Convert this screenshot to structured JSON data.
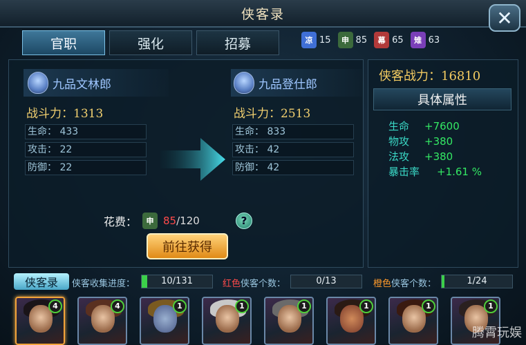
{
  "window": {
    "title": "侠客录"
  },
  "tabs": [
    {
      "label": "官职"
    },
    {
      "label": "强化"
    },
    {
      "label": "招募"
    }
  ],
  "currencies": [
    {
      "glyph": "凉",
      "value": "15",
      "color": "#3f6fd6"
    },
    {
      "glyph": "申",
      "value": "85",
      "color": "#3c6a3c"
    },
    {
      "glyph": "幕",
      "value": "65",
      "color": "#b23a3a"
    },
    {
      "glyph": "雉",
      "value": "63",
      "color": "#7a3fb8"
    }
  ],
  "current_rank": {
    "name": "九品文林郎",
    "power_label": "战斗力：",
    "power_value": "1313",
    "stats": [
      {
        "label": "生命：",
        "value": "433"
      },
      {
        "label": "攻击：",
        "value": "22"
      },
      {
        "label": "防御：",
        "value": "22"
      }
    ]
  },
  "next_rank": {
    "name": "九品登仕郎",
    "power_label": "战斗力：",
    "power_value": "2513",
    "stats": [
      {
        "label": "生命：",
        "value": "833"
      },
      {
        "label": "攻击：",
        "value": "42"
      },
      {
        "label": "防御：",
        "value": "42"
      }
    ]
  },
  "cost": {
    "label": "花费：",
    "item_glyph": "申",
    "have": "85",
    "need": "/120",
    "help": "?"
  },
  "goto_button": "前往获得",
  "summary": {
    "total_label": "侠客战力：",
    "total_value": "16810",
    "attr_header": "具体属性",
    "attrs": [
      {
        "label": "生命",
        "value": "+7600"
      },
      {
        "label": "物攻",
        "value": "+380"
      },
      {
        "label": "法攻",
        "value": "+380"
      },
      {
        "label": "暴击率",
        "value": "+1.61 %"
      }
    ]
  },
  "bottom": {
    "badge": "侠客录",
    "collect_label": "侠客收集进度：",
    "collect_value": "10/131",
    "collect_fraction": 0.076,
    "red_label_colored": "红色",
    "red_label_rest": "侠客个数：",
    "red_value": "0/13",
    "red_fraction": 0.0,
    "orange_label_colored": "橙色",
    "orange_label_rest": "侠客个数：",
    "orange_value": "1/24",
    "orange_fraction": 0.042
  },
  "heroes": [
    {
      "level": "4"
    },
    {
      "level": "4"
    },
    {
      "level": "1"
    },
    {
      "level": "1"
    },
    {
      "level": "1"
    },
    {
      "level": "1"
    },
    {
      "level": "1"
    },
    {
      "level": "1"
    }
  ],
  "watermark": "腾霄玩娱"
}
